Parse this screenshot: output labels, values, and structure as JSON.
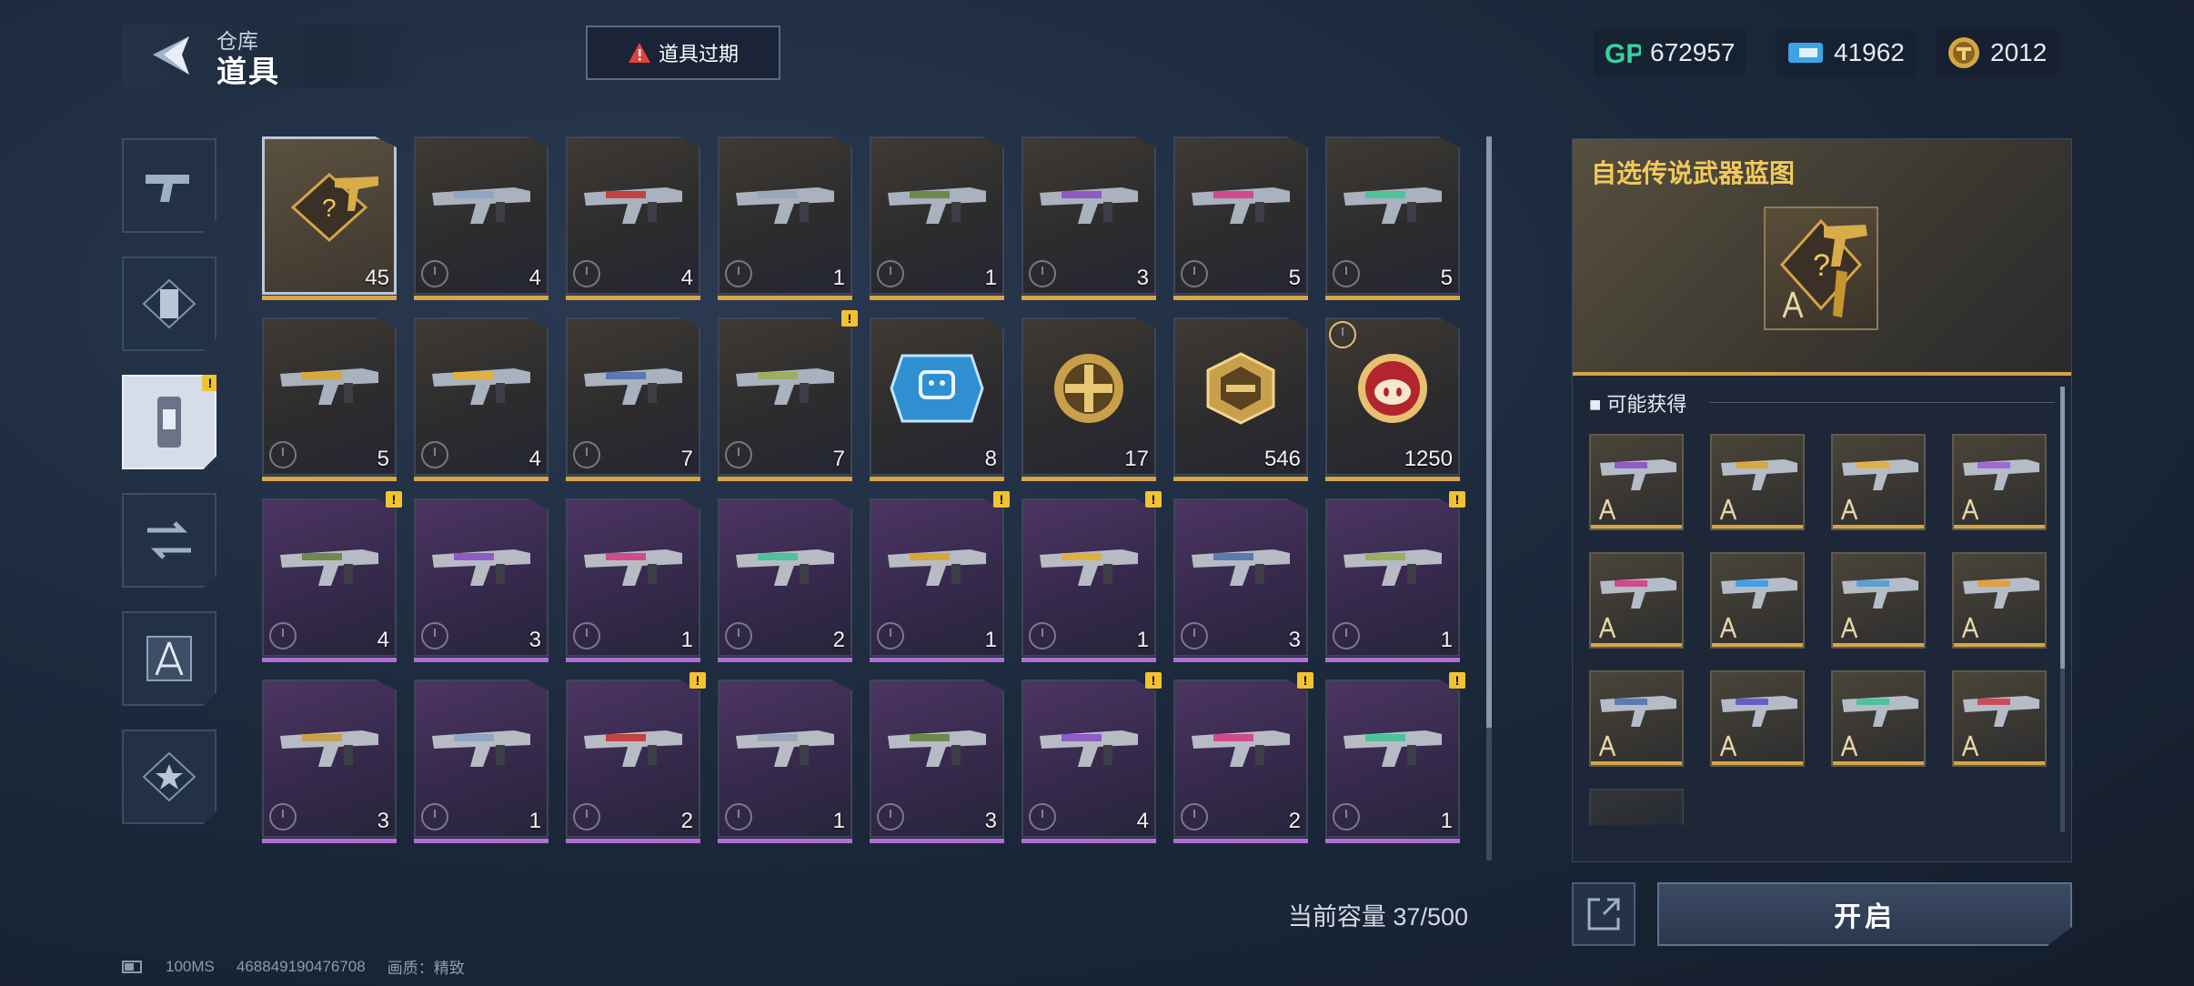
{
  "header": {
    "breadcrumb_parent": "仓库",
    "title": "道具",
    "expire_button_label": "道具过期",
    "currencies": [
      {
        "icon": "gp-icon",
        "value": "672957"
      },
      {
        "icon": "ticket-icon",
        "value": "41962"
      },
      {
        "icon": "coin-icon",
        "value": "2012"
      }
    ]
  },
  "sidebar": {
    "tabs": [
      {
        "icon": "gun-icon",
        "active": false
      },
      {
        "icon": "scroll-icon",
        "active": false
      },
      {
        "icon": "item-icon",
        "active": true,
        "alert": "!"
      },
      {
        "icon": "transfer-icon",
        "active": false
      },
      {
        "icon": "blueprint-icon",
        "active": false
      },
      {
        "icon": "star-badge-icon",
        "active": false
      }
    ]
  },
  "inventory": {
    "items": [
      {
        "count": "45",
        "rarity": "gold",
        "kind": "blueprint",
        "selected": true
      },
      {
        "count": "4",
        "rarity": "gold",
        "kind": "weapon"
      },
      {
        "count": "4",
        "rarity": "gold",
        "kind": "weapon"
      },
      {
        "count": "1",
        "rarity": "gold",
        "kind": "weapon"
      },
      {
        "count": "1",
        "rarity": "gold",
        "kind": "weapon"
      },
      {
        "count": "3",
        "rarity": "gold",
        "kind": "weapon"
      },
      {
        "count": "5",
        "rarity": "gold",
        "kind": "weapon"
      },
      {
        "count": "5",
        "rarity": "gold",
        "kind": "weapon"
      },
      {
        "count": "5",
        "rarity": "gold",
        "kind": "weapon"
      },
      {
        "count": "4",
        "rarity": "gold",
        "kind": "weapon"
      },
      {
        "count": "7",
        "rarity": "gold",
        "kind": "weapon"
      },
      {
        "count": "7",
        "rarity": "gold",
        "kind": "weapon",
        "alert": "!"
      },
      {
        "count": "8",
        "rarity": "gold",
        "kind": "chip"
      },
      {
        "count": "17",
        "rarity": "gold",
        "kind": "medal"
      },
      {
        "count": "546",
        "rarity": "gold",
        "kind": "hex-coin"
      },
      {
        "count": "1250",
        "rarity": "gold",
        "kind": "pig-coin",
        "timer": true
      },
      {
        "count": "4",
        "rarity": "purple",
        "kind": "weapon",
        "alert": "!"
      },
      {
        "count": "3",
        "rarity": "purple",
        "kind": "weapon"
      },
      {
        "count": "1",
        "rarity": "purple",
        "kind": "weapon"
      },
      {
        "count": "2",
        "rarity": "purple",
        "kind": "weapon"
      },
      {
        "count": "1",
        "rarity": "purple",
        "kind": "weapon",
        "alert": "!"
      },
      {
        "count": "1",
        "rarity": "purple",
        "kind": "weapon",
        "alert": "!"
      },
      {
        "count": "3",
        "rarity": "purple",
        "kind": "weapon"
      },
      {
        "count": "1",
        "rarity": "purple",
        "kind": "weapon",
        "alert": "!"
      },
      {
        "count": "3",
        "rarity": "purple",
        "kind": "weapon"
      },
      {
        "count": "1",
        "rarity": "purple",
        "kind": "weapon"
      },
      {
        "count": "2",
        "rarity": "purple",
        "kind": "weapon",
        "alert": "!"
      },
      {
        "count": "1",
        "rarity": "purple",
        "kind": "weapon"
      },
      {
        "count": "3",
        "rarity": "purple",
        "kind": "weapon"
      },
      {
        "count": "4",
        "rarity": "purple",
        "kind": "weapon",
        "alert": "!"
      },
      {
        "count": "2",
        "rarity": "purple",
        "kind": "weapon",
        "alert": "!"
      },
      {
        "count": "1",
        "rarity": "purple",
        "kind": "weapon",
        "alert": "!"
      }
    ],
    "capacity_label": "当前容量 37/500"
  },
  "detail": {
    "title": "自选传说武器蓝图",
    "section_label": "可能获得",
    "open_button_label": "开启",
    "rewards_count": 12
  },
  "footer": {
    "ping": "100MS",
    "player_id": "468849190476708",
    "quality": "画质：精致"
  },
  "colors": {
    "gold": "#d6a645",
    "purple": "#b06ed6",
    "title_gold": "#f1c95c",
    "alert_yellow": "#f2c230"
  }
}
